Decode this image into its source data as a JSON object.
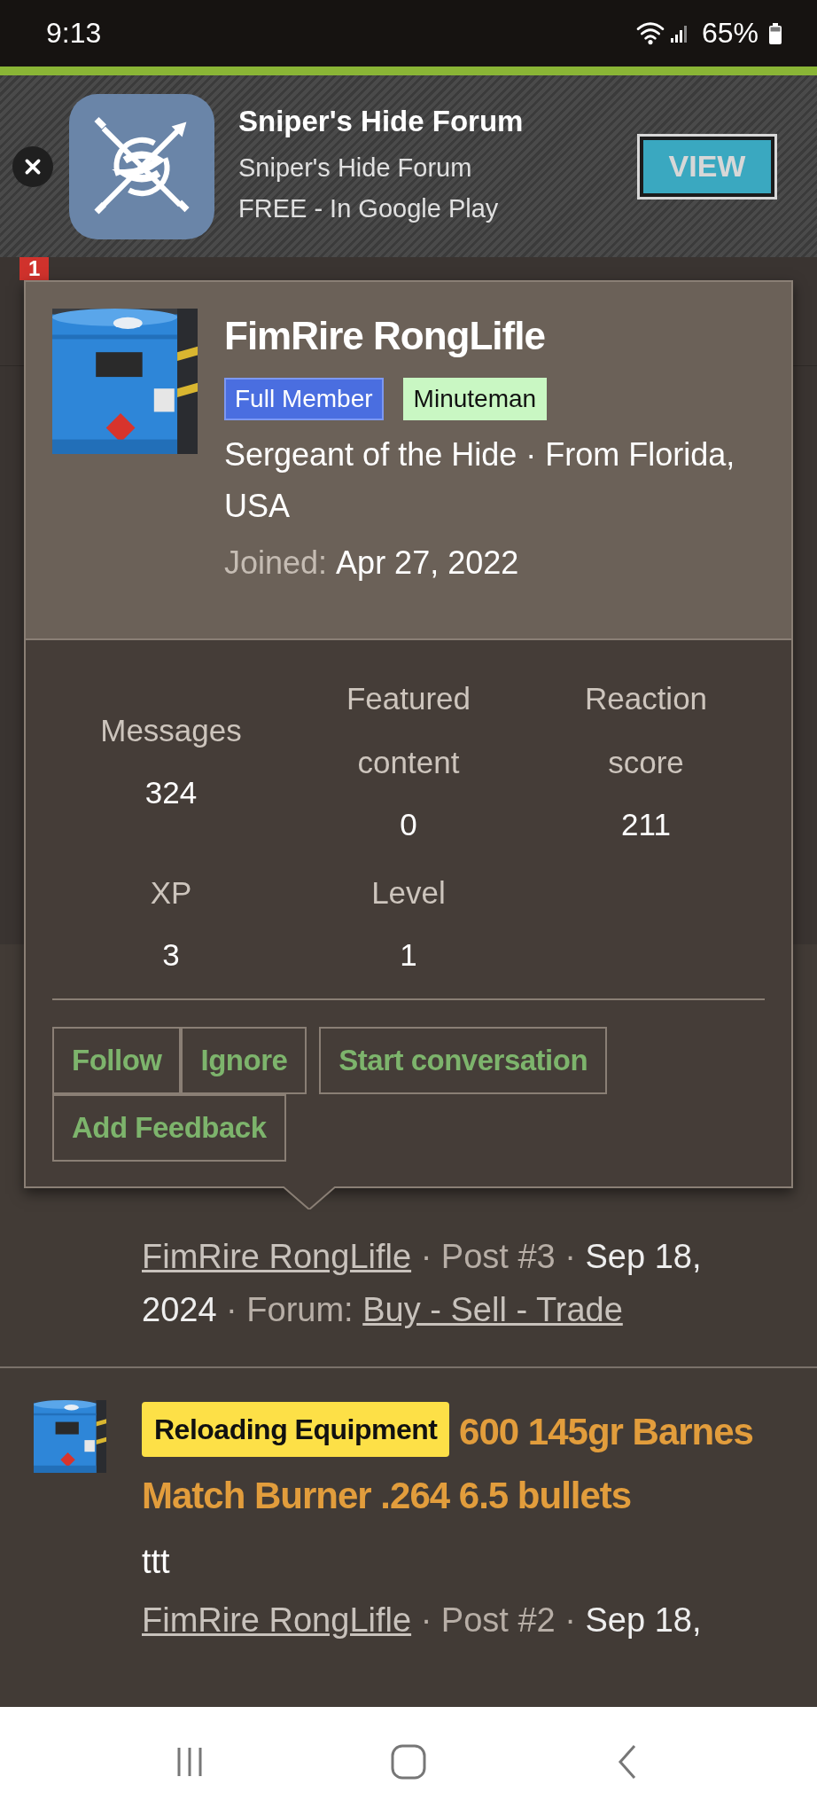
{
  "status_bar": {
    "time": "9:13",
    "battery": "65%"
  },
  "app_banner": {
    "title": "Sniper's Hide Forum",
    "subtitle": "Sniper's Hide Forum",
    "offer": "FREE - In Google Play",
    "button": "VIEW"
  },
  "header": {
    "alert_count": "1"
  },
  "member_card": {
    "name": "FimRire RongLifle",
    "banners": [
      {
        "label": "Full Member",
        "color": "#4a6ee0"
      },
      {
        "label": "Minuteman",
        "color": "#c9f7c3"
      }
    ],
    "blurb": "Sergeant of the Hide · From Florida, USA",
    "joined_label": "Joined:",
    "joined": "Apr 27, 2022",
    "stats": [
      {
        "label": "Messages",
        "value": "324"
      },
      {
        "label": "Featured content",
        "value": "0"
      },
      {
        "label": "Reaction score",
        "value": "211"
      },
      {
        "label": "XP",
        "value": "3"
      },
      {
        "label": "Level",
        "value": "1"
      }
    ],
    "button_groups": [
      [
        "Follow",
        "Ignore"
      ],
      [
        "Start conversation"
      ],
      [
        "Add Feedback"
      ]
    ]
  },
  "posts": [
    {
      "meta": {
        "author": "FimRire RongLifle",
        "post": "· Post #3 ·",
        "date": "Sep 18, 2024",
        "forum_label": "· Forum:",
        "forum": "Buy - Sell - Trade"
      }
    },
    {
      "prefix": "Reloading Equipment",
      "title": "600 145gr Barnes Match Burner .264 6.5 bullets",
      "snippet": "ttt",
      "meta": {
        "author": "FimRire RongLifle",
        "post": "· Post #2 ·",
        "date": "Sep 18,"
      }
    }
  ]
}
